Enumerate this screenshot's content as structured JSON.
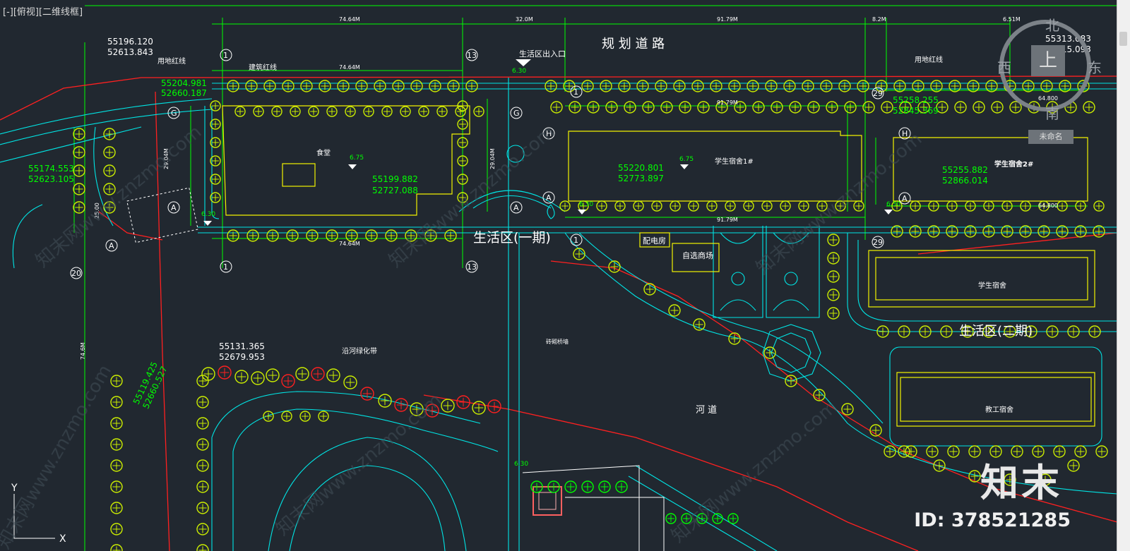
{
  "viewport": {
    "label": "[-][俯视][二维线框]"
  },
  "viewcube": {
    "north": "北",
    "south": "南",
    "east": "东",
    "west": "西",
    "top_face": "上",
    "wcs": "未命名"
  },
  "watermark": {
    "logo": "知末",
    "id": "ID: 378521285",
    "site": "知末网www.znzmo.com"
  },
  "colors": {
    "bg": "#212830",
    "green": "#00ff00",
    "cyan": "#00ffff",
    "yellow": "#ffff00",
    "red": "#ff0000",
    "white": "#ffffff"
  },
  "drawing": {
    "road_title": "规 划 道 路",
    "entrance_label": "生活区出入口",
    "zone1_label": "生活区(一期)",
    "zone2_label": "生活区(二期)",
    "river_label": "河 道",
    "canteen_label": "食堂",
    "dorm1_label": "学生宿舍1#",
    "dorm2_label": "学生宿舍2#",
    "dorm_label": "学生宿舍",
    "staff_dorm_label": "教工宿舍",
    "power_room_label": "配电房",
    "store_label": "自选商场",
    "redline_label": "用地红线",
    "building_line_label": "建筑红线",
    "green_belt_label": "沿河绿化带",
    "wall_label": "砖砌桥墙",
    "elev_675": "6.75",
    "elev_630": "6.30",
    "coords": [
      {
        "x": "55196.120",
        "y": "52613.843"
      },
      {
        "x": "55204.981",
        "y": "52660.187"
      },
      {
        "x": "55174.553",
        "y": "52623.105"
      },
      {
        "x": "55199.882",
        "y": "52727.088"
      },
      {
        "x": "55220.801",
        "y": "52773.897"
      },
      {
        "x": "55258.255",
        "y": "52845.369"
      },
      {
        "x": "55255.882",
        "y": "52866.014"
      },
      {
        "x": "55313.083",
        "y": "52915.093"
      },
      {
        "x": "55131.365",
        "y": "52679.953"
      },
      {
        "x": "55119.425",
        "y": "52660.527"
      }
    ],
    "dims": {
      "d7464": "74.64M",
      "d320": "32.0M",
      "d9179": "91.79M",
      "d82": "8.2M",
      "d651": "6.51M",
      "d2904": "29.04M",
      "d250": "25.00",
      "d746": "74.6M",
      "d648": "64.800",
      "d630": "6.30"
    },
    "grid": {
      "g1": "1",
      "g13": "13",
      "g29": "29",
      "g20": "20",
      "gG": "G",
      "gH": "H",
      "gA": "A"
    },
    "ucs": {
      "x": "X",
      "y": "Y"
    }
  }
}
